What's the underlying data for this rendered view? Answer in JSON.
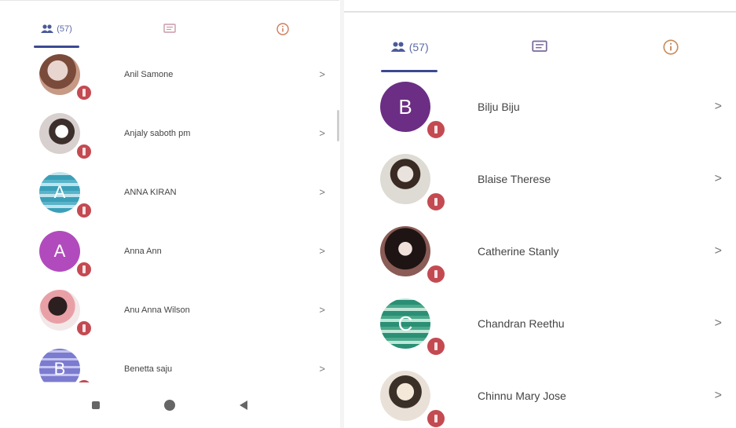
{
  "left_panel": {
    "tabs": [
      {
        "icon": "people-icon",
        "count": "(57)",
        "active": true
      },
      {
        "icon": "chat-icon",
        "active": false
      },
      {
        "icon": "info-icon",
        "active": false
      }
    ],
    "members": [
      {
        "name": "Anil Samone",
        "avatar_letter": "",
        "style": "ph1"
      },
      {
        "name": "Anjaly saboth pm",
        "avatar_letter": "",
        "style": "ph2"
      },
      {
        "name": "ANNA KIRAN",
        "avatar_letter": "A",
        "style": "ph3"
      },
      {
        "name": "Anna Ann",
        "avatar_letter": "A",
        "style": "ph4"
      },
      {
        "name": "Anu Anna Wilson",
        "avatar_letter": "",
        "style": "ph5"
      },
      {
        "name": "Benetta saju",
        "avatar_letter": "B",
        "style": "ph6"
      }
    ],
    "chevron": ">"
  },
  "right_panel": {
    "tabs": [
      {
        "icon": "people-icon",
        "count": "(57)",
        "active": true
      },
      {
        "icon": "chat-icon",
        "active": false
      },
      {
        "icon": "info-icon",
        "active": false
      }
    ],
    "members": [
      {
        "name": "Bilju Biju",
        "avatar_letter": "B",
        "style": "pb"
      },
      {
        "name": "Blaise Therese",
        "avatar_letter": "",
        "style": "pr2"
      },
      {
        "name": "Catherine Stanly",
        "avatar_letter": "",
        "style": "pr3"
      },
      {
        "name": "Chandran Reethu",
        "avatar_letter": "C",
        "style": "pr4"
      },
      {
        "name": "Chinnu Mary Jose",
        "avatar_letter": "",
        "style": "pr5"
      }
    ],
    "chevron": ">"
  },
  "colors": {
    "accent": "#3c4a92",
    "badge": "#c44a52"
  }
}
